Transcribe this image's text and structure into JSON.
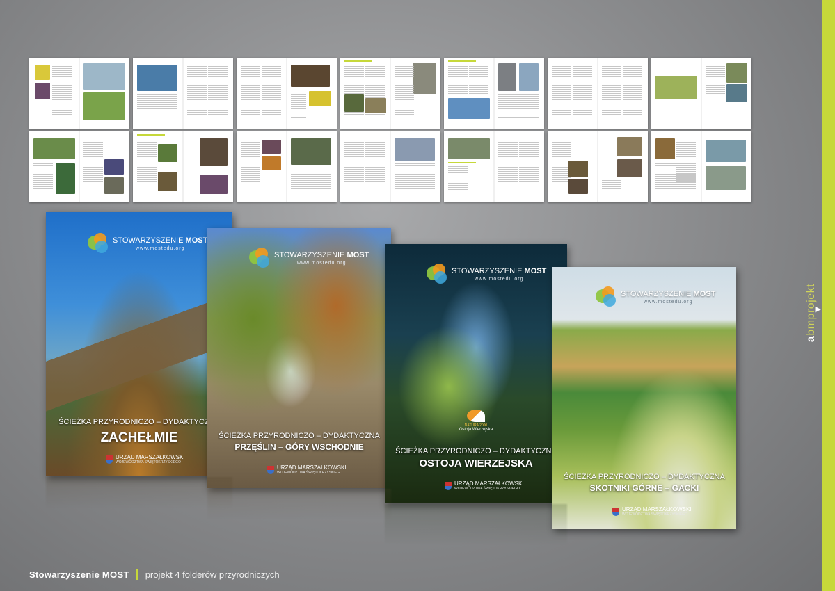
{
  "brand": {
    "accent_color": "#c6d83a",
    "logo_word_a": "a",
    "logo_word_rest": "bmprojekt",
    "next_icon": "triangle-right-icon"
  },
  "footer": {
    "client": "Stowarzyszenie MOST",
    "description": "projekt 4 folderów przyrodniczych"
  },
  "covers": [
    {
      "logo_name": "STOWARZYSZENIE",
      "logo_name_bold": "MOST",
      "url": "www.mostedu.org",
      "subtitle": "ŚCIEŻKA PRZYRODNICZO – DYDAKTYCZNA",
      "title": "ZACHEŁMIE",
      "publisher": "URZĄD MARSZAŁKOWSKI",
      "publisher_sub": "WOJEWÓDZTWA ŚWIĘTOKRZYSKIEGO"
    },
    {
      "logo_name": "STOWARZYSZENIE",
      "logo_name_bold": "MOST",
      "url": "www.mostedu.org",
      "subtitle": "ŚCIEŻKA PRZYRODNICZO – DYDAKTYCZNA",
      "title": "PRZĘŚLIN – GÓRY WSCHODNIE",
      "publisher": "URZĄD MARSZAŁKOWSKI",
      "publisher_sub": "WOJEWÓDZTWA ŚWIĘTOKRZYSKIEGO"
    },
    {
      "logo_name": "STOWARZYSZENIE",
      "logo_name_bold": "MOST",
      "url": "www.mostedu.org",
      "badge_top": "NATURA 2000",
      "badge_name": "Ostoja Wierzejska",
      "subtitle": "ŚCIEŻKA PRZYRODNICZO – DYDAKTYCZNA",
      "title": "OSTOJA WIERZEJSKA",
      "publisher": "URZĄD MARSZAŁKOWSKI",
      "publisher_sub": "WOJEWÓDZTWA ŚWIĘTOKRZYSKIEGO"
    },
    {
      "logo_name": "STOWARZYSZENIE",
      "logo_name_bold": "MOST",
      "url": "www.mostedu.org",
      "subtitle": "ŚCIEŻKA PRZYRODNICZO – DYDAKTYCZNA",
      "title": "SKOTNIKI GÓRNE – GACKI",
      "publisher": "URZĄD MARSZAŁKOWSKI",
      "publisher_sub": "WOJEWÓDZTWA ŚWIĘTOKRZYSKIEGO"
    }
  ]
}
